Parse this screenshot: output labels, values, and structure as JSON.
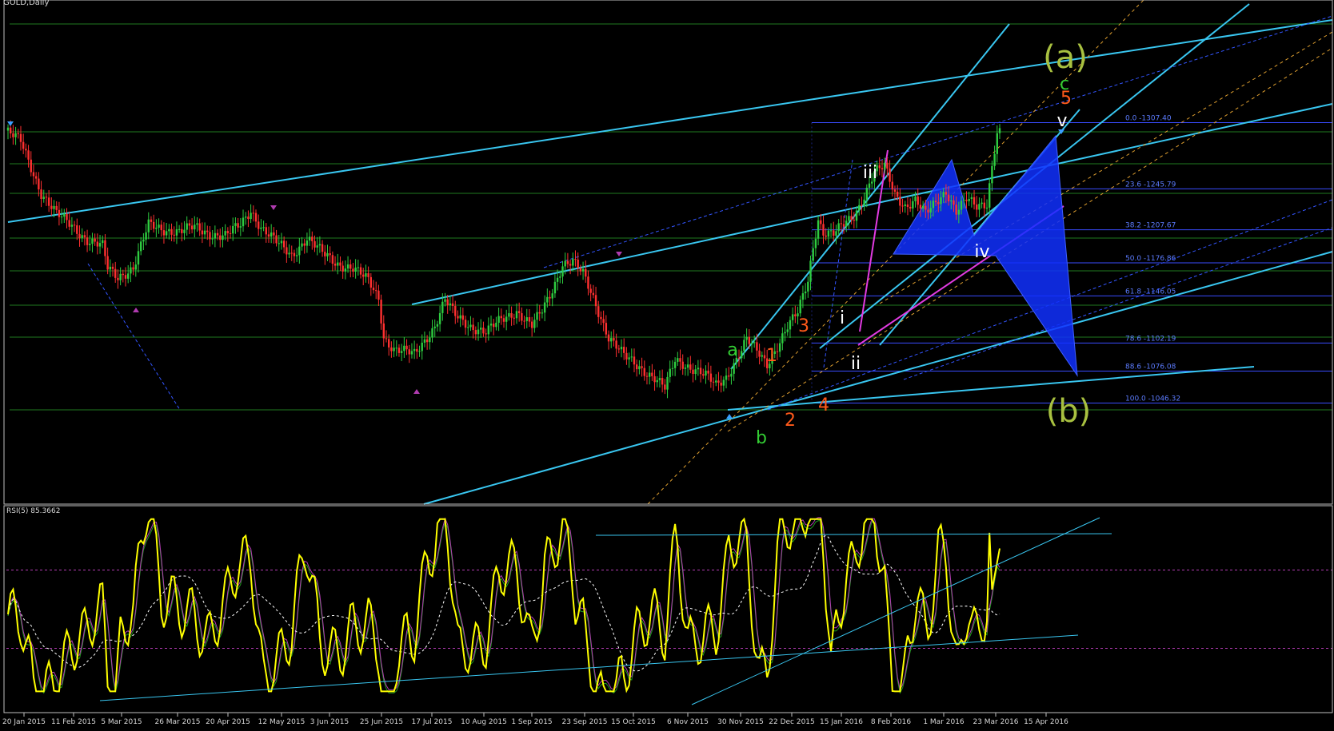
{
  "main_title": "GOLD,Daily",
  "rsi_title": "RSI(5) 85.3662",
  "colors": {
    "background": "#000000",
    "frame": "#c0c0c0",
    "bull_candle": "#2ecc40",
    "bear_candle": "#ff3030",
    "cyan_line": "#39c6f0",
    "fib_line": "#3a4cff",
    "fib_text": "#5c7cff",
    "rsi_line": "#ffff00",
    "rsi_ma": "#ffffff",
    "rsi_signal_1": "#1f9a1f",
    "rsi_signal_2": "#b33bb3",
    "pattern_fill": "#1030ff",
    "magenta_line": "#e23be2",
    "orange_dash": "#e0a030",
    "wave_green": "#33cc33",
    "wave_orange": "#ff5a1a",
    "wave_white": "#ffffff",
    "wave_olive": "#a8c040"
  },
  "fib_levels": [
    {
      "label": "0.0 -1307.40",
      "value": 1307.4
    },
    {
      "label": "23.6 -1245.79",
      "value": 1245.79
    },
    {
      "label": "38.2 -1207.67",
      "value": 1207.67
    },
    {
      "label": "50.0 -1176.86",
      "value": 1176.86
    },
    {
      "label": "61.8 -1146.05",
      "value": 1146.05
    },
    {
      "label": "78.6 -1102.19",
      "value": 1102.19
    },
    {
      "label": "88.6 -1076.08",
      "value": 1076.08
    },
    {
      "label": "100.0 -1046.32",
      "value": 1046.32
    }
  ],
  "wave_labels": [
    {
      "text": "(a)",
      "color": "wave_olive",
      "size": "big"
    },
    {
      "text": "c",
      "color": "wave_green",
      "size": "mid"
    },
    {
      "text": "5",
      "color": "wave_orange",
      "size": "mid"
    },
    {
      "text": "v",
      "color": "wave_white",
      "size": "mid"
    },
    {
      "text": "iii",
      "color": "wave_white",
      "size": "mid"
    },
    {
      "text": "iv",
      "color": "wave_white",
      "size": "mid"
    },
    {
      "text": "i",
      "color": "wave_white",
      "size": "mid"
    },
    {
      "text": "ii",
      "color": "wave_white",
      "size": "mid"
    },
    {
      "text": "3",
      "color": "wave_orange",
      "size": "mid"
    },
    {
      "text": "1",
      "color": "wave_orange",
      "size": "mid"
    },
    {
      "text": "a",
      "color": "wave_green",
      "size": "mid"
    },
    {
      "text": "2",
      "color": "wave_orange",
      "size": "mid"
    },
    {
      "text": "4",
      "color": "wave_orange",
      "size": "mid"
    },
    {
      "text": "b",
      "color": "wave_green",
      "size": "mid"
    },
    {
      "text": "(b)",
      "color": "wave_olive",
      "size": "big"
    }
  ],
  "chart_data": {
    "type": "candlestick",
    "title": "GOLD,Daily",
    "x_ticks": [
      "20 Jan 2015",
      "11 Feb 2015",
      "5 Mar 2015",
      "26 Mar 2015",
      "20 Apr 2015",
      "12 May 2015",
      "3 Jun 2015",
      "25 Jun 2015",
      "17 Jul 2015",
      "10 Aug 2015",
      "1 Sep 2015",
      "23 Sep 2015",
      "15 Oct 2015",
      "6 Nov 2015",
      "30 Nov 2015",
      "22 Dec 2015",
      "15 Jan 2016",
      "8 Feb 2016",
      "1 Mar 2016",
      "23 Mar 2016",
      "15 Apr 2016"
    ],
    "price_path": [
      [
        0,
        1300
      ],
      [
        6,
        1290
      ],
      [
        14,
        1242
      ],
      [
        20,
        1222
      ],
      [
        26,
        1212
      ],
      [
        32,
        1198
      ],
      [
        38,
        1192
      ],
      [
        40,
        1172
      ],
      [
        44,
        1164
      ],
      [
        50,
        1172
      ],
      [
        56,
        1212
      ],
      [
        62,
        1208
      ],
      [
        68,
        1206
      ],
      [
        74,
        1210
      ],
      [
        80,
        1204
      ],
      [
        86,
        1202
      ],
      [
        92,
        1212
      ],
      [
        96,
        1226
      ],
      [
        100,
        1210
      ],
      [
        106,
        1196
      ],
      [
        112,
        1184
      ],
      [
        118,
        1200
      ],
      [
        124,
        1186
      ],
      [
        130,
        1176
      ],
      [
        136,
        1172
      ],
      [
        142,
        1160
      ],
      [
        146,
        1144
      ],
      [
        148,
        1108
      ],
      [
        152,
        1096
      ],
      [
        160,
        1092
      ],
      [
        168,
        1118
      ],
      [
        172,
        1142
      ],
      [
        176,
        1128
      ],
      [
        182,
        1118
      ],
      [
        188,
        1112
      ],
      [
        194,
        1124
      ],
      [
        200,
        1132
      ],
      [
        206,
        1118
      ],
      [
        210,
        1132
      ],
      [
        214,
        1152
      ],
      [
        218,
        1176
      ],
      [
        222,
        1178
      ],
      [
        226,
        1166
      ],
      [
        230,
        1144
      ],
      [
        236,
        1108
      ],
      [
        242,
        1090
      ],
      [
        248,
        1080
      ],
      [
        254,
        1070
      ],
      [
        258,
        1060
      ],
      [
        262,
        1086
      ],
      [
        266,
        1082
      ],
      [
        270,
        1078
      ],
      [
        274,
        1072
      ],
      [
        278,
        1062
      ],
      [
        282,
        1070
      ],
      [
        286,
        1088
      ],
      [
        290,
        1106
      ],
      [
        294,
        1094
      ],
      [
        298,
        1082
      ],
      [
        302,
        1100
      ],
      [
        306,
        1118
      ],
      [
        310,
        1130
      ],
      [
        314,
        1160
      ],
      [
        316,
        1192
      ],
      [
        318,
        1218
      ],
      [
        320,
        1206
      ],
      [
        324,
        1204
      ],
      [
        328,
        1212
      ],
      [
        332,
        1220
      ],
      [
        336,
        1240
      ],
      [
        340,
        1262
      ],
      [
        344,
        1266
      ],
      [
        348,
        1240
      ],
      [
        352,
        1230
      ],
      [
        356,
        1236
      ],
      [
        360,
        1222
      ],
      [
        364,
        1232
      ],
      [
        368,
        1244
      ],
      [
        372,
        1226
      ],
      [
        376,
        1236
      ],
      [
        380,
        1228
      ],
      [
        384,
        1232
      ],
      [
        386,
        1268
      ],
      [
        388,
        1300
      ]
    ],
    "rsi": {
      "label": "RSI(5) 85.3662",
      "value": 85.3662,
      "levels": [
        70,
        30
      ],
      "ylim": [
        0,
        100
      ]
    }
  }
}
